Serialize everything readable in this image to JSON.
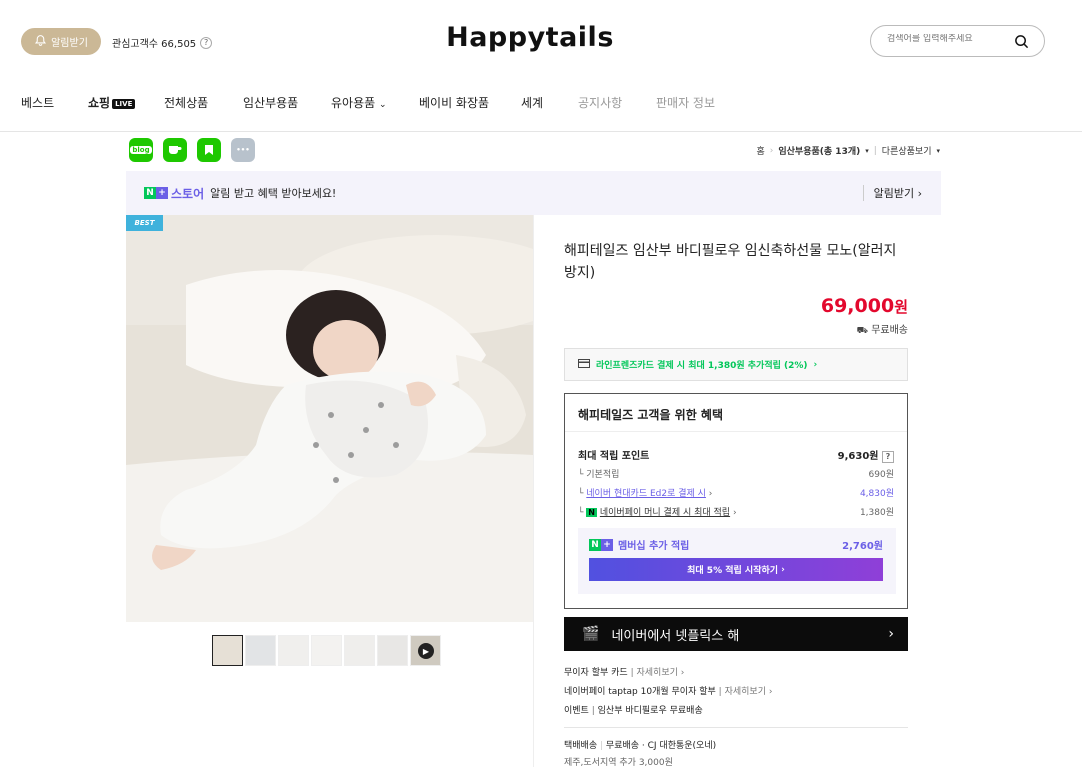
{
  "header": {
    "alarm_label": "알림받기",
    "interest_label": "관심고객수 66,505",
    "logo": "Happytails",
    "search_placeholder": "검색어를 입력해주세요"
  },
  "nav": {
    "items": [
      "베스트",
      "쇼핑",
      "전체상품",
      "임산부용품",
      "유아용품",
      "베이비 화장품",
      "세계",
      "공지사항",
      "판매자 정보"
    ],
    "live_badge": "LIVE"
  },
  "share": {
    "items": [
      "blog",
      "cafe",
      "band",
      "more"
    ]
  },
  "breadcrumb": {
    "home": "홈",
    "category": "임산부용품(총 13개)",
    "other": "다른상품보기"
  },
  "banner": {
    "brand": "스토어",
    "text": "알림 받고 혜택 받아보세요!",
    "action": "알림받기"
  },
  "product": {
    "badge": "BEST",
    "title": "해피테일즈 임산부 바디필로우 임신축하선물 모노(알러지방지)",
    "price": "69,000",
    "currency": "원",
    "shipping": "무료배송",
    "card_benefit": "라인프렌즈카드 결제 시 최대 1,380원 추가적립 (2%)"
  },
  "benefit": {
    "title": "해피테일즈 고객을 위한 혜택",
    "max_points_label": "최대 적립 포인트",
    "max_points_value": "9,630원",
    "rows": [
      {
        "label": "기본적립",
        "value": "690원"
      },
      {
        "label": "네이버 현대카드 Ed2로 결제 시",
        "value": "4,830원"
      },
      {
        "label": "네이버페이 머니 결제 시 최대 적립",
        "value": "1,380원"
      }
    ],
    "membership_label": "멤버십 추가 적립",
    "membership_value": "2,760원",
    "cta": "최대 5% 적립 시작하기"
  },
  "netflix": {
    "text": "네이버에서 넷플릭스 해"
  },
  "links": [
    {
      "label": "무이자 할부 카드",
      "action": "자세히보기"
    },
    {
      "label": "네이버페이 taptap 10개월 무이자 할부",
      "action": "자세히보기"
    },
    {
      "label": "이벤트",
      "action": "임산부 바디필로우 무료배송"
    }
  ],
  "delivery": {
    "line1_a": "택배배송",
    "line1_b": "무료배송 · CJ 대한통운(오네)",
    "line2": "제주,도서지역 추가 3,000원"
  },
  "colors": {
    "accent_red": "#e3082d",
    "naver_green": "#03c75a",
    "alarm_beige": "#cbb896"
  }
}
